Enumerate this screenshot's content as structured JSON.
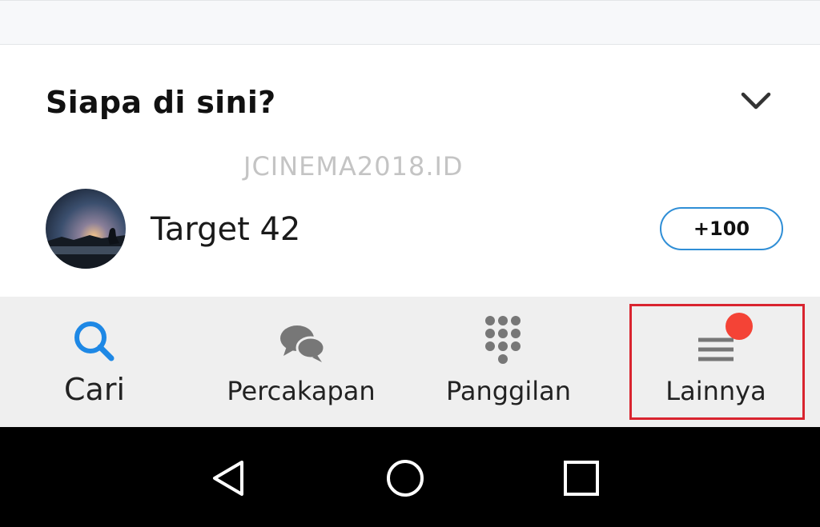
{
  "section": {
    "title": "Siapa di sini?"
  },
  "watermark": "JCINEMA2018.ID",
  "list": {
    "items": [
      {
        "name": "Target 42",
        "badge": "+100"
      }
    ]
  },
  "bottom_nav": {
    "items": [
      {
        "label": "Cari",
        "icon": "search-icon",
        "color": "#1e88e5"
      },
      {
        "label": "Percakapan",
        "icon": "chat-bubbles-icon",
        "color": "#777777"
      },
      {
        "label": "Panggilan",
        "icon": "dialpad-icon",
        "color": "#777777"
      },
      {
        "label": "Lainnya",
        "icon": "menu-icon",
        "color": "#777777",
        "notification_dot": true
      }
    ]
  },
  "colors": {
    "accent_blue": "#1e88e5",
    "badge_border": "#2f8ed6",
    "notification_red": "#f44336",
    "highlight_red": "#d9242f"
  },
  "system_nav": {
    "buttons": [
      "back-icon",
      "home-icon",
      "recents-icon"
    ]
  }
}
